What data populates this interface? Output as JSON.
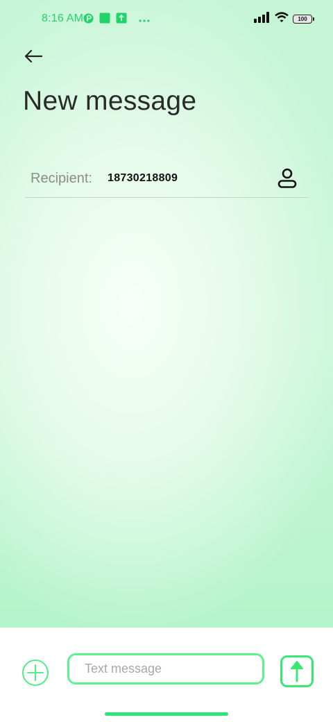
{
  "status_bar": {
    "time": "8:16 AM",
    "left_icons": [
      "app-circle-icon",
      "app-square-icon",
      "upload-square-icon",
      "more-dots-icon"
    ],
    "battery_level": "100",
    "accent_color": "#22d26a"
  },
  "header": {
    "back_icon": "arrow-left-icon",
    "title": "New message"
  },
  "recipient": {
    "label": "Recipient:",
    "value": "18730218809",
    "contact_icon": "person-icon"
  },
  "compose": {
    "placeholder": "Text message",
    "value": "",
    "attach_icon": "plus-circle-icon",
    "send_icon": "arrow-up-icon",
    "accent_color": "#38e875"
  }
}
